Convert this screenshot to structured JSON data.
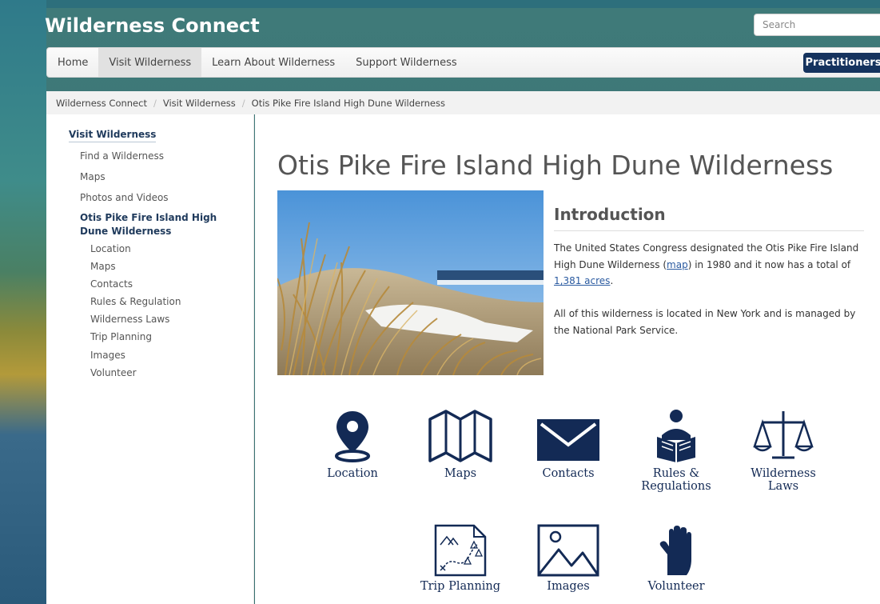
{
  "site": {
    "title": "Wilderness Connect",
    "search_placeholder": "Search"
  },
  "nav": {
    "items": [
      {
        "label": "Home",
        "active": false
      },
      {
        "label": "Visit Wilderness",
        "active": true
      },
      {
        "label": "Learn About Wilderness",
        "active": false
      },
      {
        "label": "Support Wilderness",
        "active": false
      }
    ],
    "practitioners_label": "Practitioners"
  },
  "breadcrumb": [
    "Wilderness Connect",
    "Visit Wilderness",
    "Otis Pike Fire Island High Dune Wilderness"
  ],
  "sidebar": {
    "heading": "Visit Wilderness",
    "links": [
      "Find a Wilderness",
      "Maps",
      "Photos and Videos"
    ],
    "current": "Otis Pike Fire Island High Dune Wilderness",
    "sublinks": [
      "Location",
      "Maps",
      "Contacts",
      "Rules & Regulation",
      "Wilderness Laws",
      "Trip Planning",
      "Images",
      "Volunteer"
    ]
  },
  "page": {
    "title": "Otis Pike Fire Island High Dune Wilderness",
    "intro_heading": "Introduction",
    "para1_a": "The United States Congress designated the Otis Pike Fire Island High Dune Wilderness (",
    "para1_map": "map",
    "para1_b": ") in 1980 and it now has a total of",
    "para1_acres": "1,381 acres",
    "para1_end": ".",
    "para2": "All of this wilderness is located in New York and is managed by the National Park Service."
  },
  "icons": [
    {
      "label": "Location",
      "icon": "location-pin-icon"
    },
    {
      "label": "Maps",
      "icon": "folded-map-icon"
    },
    {
      "label": "Contacts",
      "icon": "envelope-icon"
    },
    {
      "label": "Rules & Regulations",
      "icon": "reading-person-icon"
    },
    {
      "label": "Wilderness Laws",
      "icon": "scales-icon"
    },
    {
      "label": "Trip Planning",
      "icon": "trip-map-icon"
    },
    {
      "label": "Images",
      "icon": "image-icon"
    },
    {
      "label": "Volunteer",
      "icon": "raised-hand-icon"
    }
  ],
  "colors": {
    "brand_navy": "#132a55",
    "practitioners_bg": "#15335e",
    "header_teal": "#3f7a79"
  }
}
